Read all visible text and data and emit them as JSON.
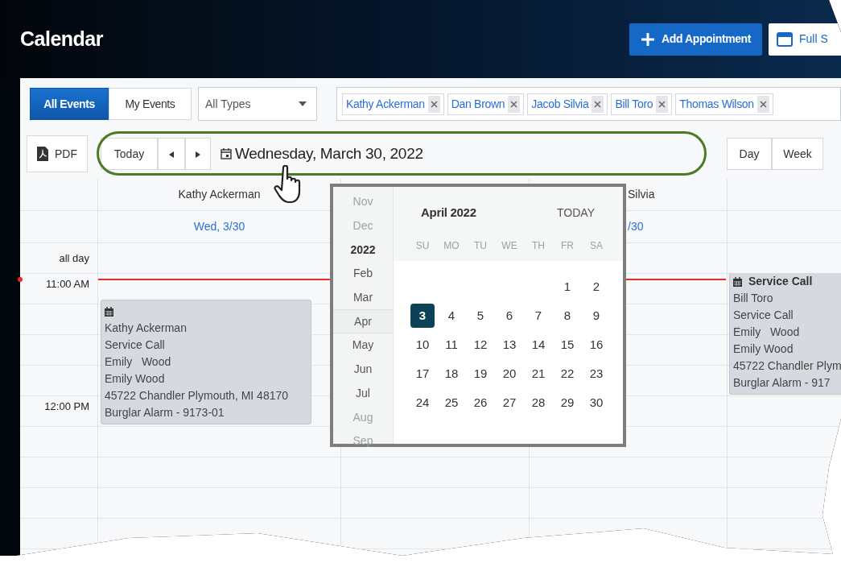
{
  "header": {
    "title": "Calendar",
    "buttons": [
      {
        "label": "Add Appointment",
        "kind": "primary"
      },
      {
        "label": "Full S",
        "kind": "outline"
      }
    ]
  },
  "filters": {
    "view_toggle": [
      {
        "label": "All Events",
        "selected": true
      },
      {
        "label": "My Events",
        "selected": false
      }
    ],
    "type_select": "All Types",
    "people": [
      "Kathy Ackerman",
      "Dan Brown",
      "Jacob Silvia",
      "Bill Toro",
      "Thomas Wilson"
    ]
  },
  "toolbar": {
    "export": "PDF",
    "today": "Today",
    "date": "Wednesday, March 30, 2022",
    "views": [
      {
        "label": "Day",
        "selected": false
      },
      {
        "label": "Week",
        "selected": false
      }
    ]
  },
  "grid": {
    "all_day_label": "all day",
    "hours": [
      "11:00 AM",
      "12:00 PM"
    ],
    "columns": [
      {
        "name": "Kathy Ackerman",
        "date": "Wed, 3/30",
        "events": [
          {
            "lines": [
              "Kathy Ackerman",
              "Service Call",
              "Emily   Wood",
              "Emily Wood",
              "45722 Chandler Plymouth, MI 48170",
              "Burglar Alarm - 9173-01"
            ]
          }
        ]
      },
      {},
      {
        "name": "Silvia",
        "date": "/30"
      },
      {
        "events": [
          {
            "title": "Service Call",
            "lines": [
              "Bill Toro",
              "Service Call",
              "Emily   Wood",
              "Emily Wood",
              "45722 Chandler Plym",
              "Burglar Alarm - 917"
            ]
          }
        ]
      }
    ]
  },
  "date_picker": {
    "months": [
      {
        "label": "Nov",
        "kind": "month",
        "faded": true,
        "selected": false
      },
      {
        "label": "Dec",
        "kind": "month",
        "faded": true,
        "selected": false
      },
      {
        "label": "2022",
        "kind": "year",
        "faded": false,
        "selected": false
      },
      {
        "label": "Feb",
        "kind": "month",
        "faded": false,
        "selected": false
      },
      {
        "label": "Mar",
        "kind": "month",
        "faded": false,
        "selected": false
      },
      {
        "label": "Apr",
        "kind": "month",
        "faded": false,
        "selected": true
      },
      {
        "label": "May",
        "kind": "month",
        "faded": false,
        "selected": false
      },
      {
        "label": "Jun",
        "kind": "month",
        "faded": false,
        "selected": false
      },
      {
        "label": "Jul",
        "kind": "month",
        "faded": false,
        "selected": false
      },
      {
        "label": "Aug",
        "kind": "month",
        "faded": true,
        "selected": false
      },
      {
        "label": "Sep",
        "kind": "month",
        "faded": true,
        "selected": false
      }
    ],
    "title": "April 2022",
    "today": "TODAY",
    "weekdays": [
      "SU",
      "MO",
      "TU",
      "WE",
      "TH",
      "FR",
      "SA"
    ],
    "days": [
      {
        "kind": "blank"
      },
      {
        "kind": "blank"
      },
      {
        "kind": "blank"
      },
      {
        "kind": "blank"
      },
      {
        "kind": "blank"
      },
      {
        "day": "1",
        "selected": false
      },
      {
        "day": "2",
        "selected": false
      },
      {
        "day": "3",
        "selected": true
      },
      {
        "day": "4",
        "selected": false
      },
      {
        "day": "5",
        "selected": false
      },
      {
        "day": "6",
        "selected": false
      },
      {
        "day": "7",
        "selected": false
      },
      {
        "day": "8",
        "selected": false
      },
      {
        "day": "9",
        "selected": false
      },
      {
        "day": "10",
        "selected": false
      },
      {
        "day": "11",
        "selected": false
      },
      {
        "day": "12",
        "selected": false
      },
      {
        "day": "13",
        "selected": false
      },
      {
        "day": "14",
        "selected": false
      },
      {
        "day": "15",
        "selected": false
      },
      {
        "day": "16",
        "selected": false
      },
      {
        "day": "17",
        "selected": false
      },
      {
        "day": "18",
        "selected": false
      },
      {
        "day": "19",
        "selected": false
      },
      {
        "day": "20",
        "selected": false
      },
      {
        "day": "21",
        "selected": false
      },
      {
        "day": "22",
        "selected": false
      },
      {
        "day": "23",
        "selected": false
      },
      {
        "day": "24",
        "selected": false
      },
      {
        "day": "25",
        "selected": false
      },
      {
        "day": "26",
        "selected": false
      },
      {
        "day": "27",
        "selected": false
      },
      {
        "day": "28",
        "selected": false
      },
      {
        "day": "29",
        "selected": false
      },
      {
        "day": "30",
        "selected": false
      }
    ]
  }
}
